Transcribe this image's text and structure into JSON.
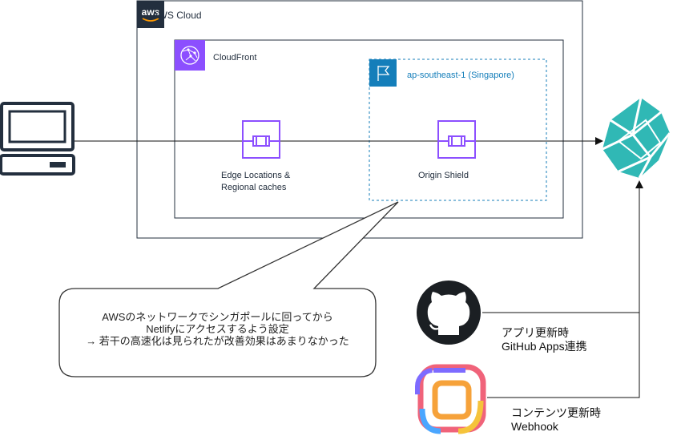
{
  "aws_cloud": {
    "title": "AWS Cloud",
    "logo_text": "aws"
  },
  "cloudfront": {
    "title": "CloudFront"
  },
  "region": {
    "title": "ap-southeast-1 (Singapore)"
  },
  "edge": {
    "label_line1": "Edge Locations &",
    "label_line2": "Regional caches"
  },
  "origin_shield": {
    "label": "Origin Shield"
  },
  "callout": {
    "lines": [
      "AWSのネットワークでシンガポールに回ってから",
      "Netlifyにアクセスするよう設定",
      "→ 若干の高速化は見られたが改善効果はあまりなかった"
    ]
  },
  "github_note": {
    "line1": "アプリ更新時",
    "line2": "GitHub Apps連携"
  },
  "cms_note": {
    "line1": "コンテンツ更新時",
    "line2": "Webhook"
  },
  "colors": {
    "aws_dark": "#232f3e",
    "cloudfront_purple": "#8c4fff",
    "region_blue": "#147eba",
    "netlify_teal": "#30b8b5",
    "github_black": "#1b1f23"
  },
  "icons": {
    "client": "laptop-icon",
    "aws": "aws-logo-icon",
    "cloudfront": "cloudfront-icon",
    "region": "region-flag-icon",
    "edge": "edge-location-icon",
    "shield": "origin-shield-icon",
    "netlify": "netlify-logo-icon",
    "github": "github-logo-icon",
    "cms": "cms-logo-icon"
  }
}
